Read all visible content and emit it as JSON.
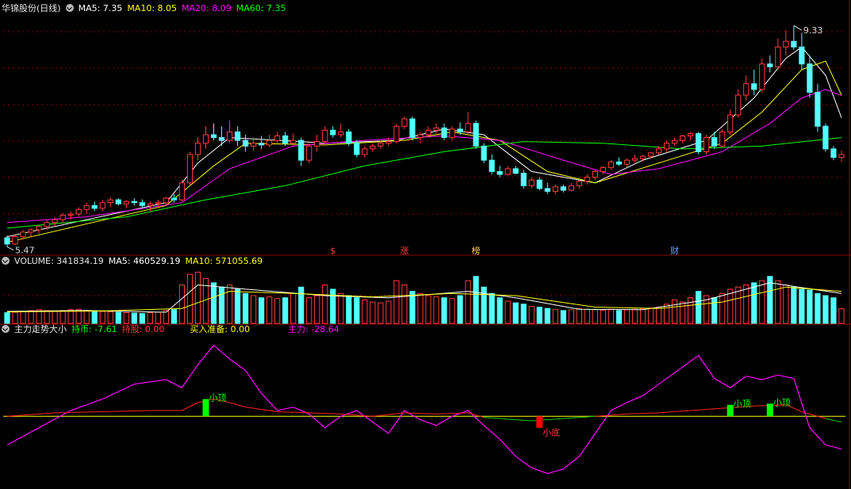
{
  "header": {
    "stock_name": "华锦股份(日线)",
    "ma5": "MA5: 7.35",
    "ma10": "MA10: 8.05",
    "ma20": "MA20: 8.09",
    "ma60": "MA60: 7.35"
  },
  "volume_header": {
    "volume": "VOLUME: 341834.19",
    "ma5": "MA5: 460529.19",
    "ma10": "MA10: 571055.69"
  },
  "indicator_header": {
    "name": "主力走势大小",
    "hold_coin": "持币: -7.61",
    "hold_stock": "持股: 0.00",
    "buy_ready": "买入准备: 0.00",
    "main_force": "主力: -28.64"
  },
  "price_labels": {
    "high": "9.33",
    "low": "5.47"
  },
  "event_markers": [
    {
      "text": "$",
      "i": 41,
      "color": "#ff3c3c"
    },
    {
      "text": "涨",
      "i": 50,
      "color": "#ff3c3c"
    },
    {
      "text": "榜",
      "i": 59,
      "color": "#ffcc55"
    },
    {
      "text": "财",
      "i": 84,
      "color": "#6aa0ff"
    }
  ],
  "signal_labels": [
    {
      "text": "小顶",
      "i": 25,
      "color": "#00ff00"
    },
    {
      "text": "小底",
      "i": 67,
      "color": "#ff3c3c"
    },
    {
      "text": "小顶",
      "i": 91,
      "color": "#00ff00"
    },
    {
      "text": "小顶",
      "i": 96,
      "color": "#00ff00"
    }
  ],
  "colors": {
    "up": "#ff3c3c",
    "down": "#54ffff",
    "ma5": "#ffffff",
    "ma10": "#ffff00",
    "ma20": "#ff00ff",
    "ma60": "#00ff00",
    "grid": "#8b0000",
    "separator": "#8b0000"
  },
  "chart_data": {
    "type": "candlestick",
    "title": "华锦股份(日线)",
    "ylim": [
      5.3,
      9.5
    ],
    "ohlc": [
      [
        5.58,
        5.62,
        5.42,
        5.47
      ],
      [
        5.47,
        5.65,
        5.45,
        5.6
      ],
      [
        5.6,
        5.72,
        5.55,
        5.68
      ],
      [
        5.68,
        5.75,
        5.6,
        5.72
      ],
      [
        5.72,
        5.8,
        5.65,
        5.78
      ],
      [
        5.78,
        5.9,
        5.72,
        5.85
      ],
      [
        5.85,
        5.95,
        5.78,
        5.9
      ],
      [
        5.9,
        6.02,
        5.85,
        5.98
      ],
      [
        5.98,
        6.05,
        5.9,
        6.0
      ],
      [
        6.0,
        6.12,
        5.95,
        6.08
      ],
      [
        6.08,
        6.2,
        6.0,
        6.15
      ],
      [
        6.15,
        6.22,
        6.05,
        6.1
      ],
      [
        6.1,
        6.25,
        6.05,
        6.2
      ],
      [
        6.2,
        6.3,
        6.12,
        6.25
      ],
      [
        6.25,
        6.28,
        6.15,
        6.18
      ],
      [
        6.18,
        6.25,
        6.1,
        6.22
      ],
      [
        6.22,
        6.28,
        6.15,
        6.2
      ],
      [
        6.2,
        6.26,
        6.12,
        6.15
      ],
      [
        6.15,
        6.22,
        6.05,
        6.18
      ],
      [
        6.18,
        6.25,
        6.1,
        6.2
      ],
      [
        6.2,
        6.3,
        6.15,
        6.28
      ],
      [
        6.28,
        6.35,
        6.2,
        6.25
      ],
      [
        6.25,
        6.6,
        6.22,
        6.55
      ],
      [
        6.55,
        7.1,
        6.5,
        7.05
      ],
      [
        7.05,
        7.35,
        6.95,
        7.25
      ],
      [
        7.25,
        7.55,
        7.15,
        7.4
      ],
      [
        7.4,
        7.6,
        7.3,
        7.35
      ],
      [
        7.35,
        7.55,
        7.2,
        7.3
      ],
      [
        7.3,
        7.65,
        7.25,
        7.45
      ],
      [
        7.45,
        7.55,
        7.2,
        7.3
      ],
      [
        7.3,
        7.4,
        7.1,
        7.2
      ],
      [
        7.2,
        7.35,
        7.12,
        7.25
      ],
      [
        7.25,
        7.38,
        7.15,
        7.22
      ],
      [
        7.22,
        7.4,
        7.18,
        7.3
      ],
      [
        7.3,
        7.45,
        7.25,
        7.38
      ],
      [
        7.38,
        7.45,
        7.2,
        7.25
      ],
      [
        7.25,
        7.42,
        7.2,
        7.3
      ],
      [
        7.3,
        7.35,
        6.85,
        6.95
      ],
      [
        6.95,
        7.25,
        6.9,
        7.2
      ],
      [
        7.2,
        7.4,
        7.1,
        7.28
      ],
      [
        7.28,
        7.55,
        7.25,
        7.48
      ],
      [
        7.48,
        7.55,
        7.35,
        7.4
      ],
      [
        7.4,
        7.6,
        7.35,
        7.45
      ],
      [
        7.45,
        7.5,
        7.2,
        7.25
      ],
      [
        7.25,
        7.3,
        7.0,
        7.05
      ],
      [
        7.05,
        7.2,
        7.0,
        7.15
      ],
      [
        7.15,
        7.25,
        7.1,
        7.2
      ],
      [
        7.2,
        7.3,
        7.15,
        7.25
      ],
      [
        7.25,
        7.35,
        7.2,
        7.28
      ],
      [
        7.28,
        7.6,
        7.25,
        7.55
      ],
      [
        7.55,
        7.72,
        7.5,
        7.68
      ],
      [
        7.68,
        7.72,
        7.3,
        7.35
      ],
      [
        7.35,
        7.45,
        7.25,
        7.4
      ],
      [
        7.4,
        7.55,
        7.35,
        7.48
      ],
      [
        7.48,
        7.6,
        7.4,
        7.52
      ],
      [
        7.52,
        7.6,
        7.3,
        7.35
      ],
      [
        7.35,
        7.55,
        7.3,
        7.5
      ],
      [
        7.5,
        7.62,
        7.4,
        7.45
      ],
      [
        7.45,
        7.8,
        7.4,
        7.6
      ],
      [
        7.6,
        7.65,
        7.15,
        7.2
      ],
      [
        7.2,
        7.25,
        6.9,
        6.95
      ],
      [
        6.95,
        7.05,
        6.7,
        6.75
      ],
      [
        6.75,
        6.85,
        6.65,
        6.7
      ],
      [
        6.7,
        6.85,
        6.68,
        6.8
      ],
      [
        6.8,
        6.85,
        6.7,
        6.72
      ],
      [
        6.72,
        6.78,
        6.45,
        6.5
      ],
      [
        6.5,
        6.65,
        6.45,
        6.6
      ],
      [
        6.6,
        6.65,
        6.42,
        6.45
      ],
      [
        6.45,
        6.55,
        6.35,
        6.4
      ],
      [
        6.4,
        6.52,
        6.35,
        6.48
      ],
      [
        6.48,
        6.52,
        6.38,
        6.42
      ],
      [
        6.42,
        6.55,
        6.4,
        6.5
      ],
      [
        6.5,
        6.6,
        6.45,
        6.58
      ],
      [
        6.58,
        6.7,
        6.52,
        6.65
      ],
      [
        6.65,
        6.78,
        6.6,
        6.75
      ],
      [
        6.75,
        6.85,
        6.7,
        6.82
      ],
      [
        6.82,
        6.95,
        6.78,
        6.92
      ],
      [
        6.92,
        7.0,
        6.85,
        6.88
      ],
      [
        6.88,
        6.98,
        6.82,
        6.95
      ],
      [
        6.95,
        7.05,
        6.9,
        6.98
      ],
      [
        6.98,
        7.05,
        6.92,
        7.02
      ],
      [
        7.02,
        7.1,
        6.98,
        7.08
      ],
      [
        7.08,
        7.2,
        7.05,
        7.15
      ],
      [
        7.15,
        7.3,
        7.1,
        7.25
      ],
      [
        7.25,
        7.35,
        7.2,
        7.3
      ],
      [
        7.3,
        7.4,
        7.25,
        7.38
      ],
      [
        7.38,
        7.45,
        7.3,
        7.42
      ],
      [
        7.42,
        7.45,
        7.05,
        7.1
      ],
      [
        7.1,
        7.4,
        7.05,
        7.35
      ],
      [
        7.35,
        7.45,
        7.15,
        7.2
      ],
      [
        7.2,
        7.5,
        7.18,
        7.45
      ],
      [
        7.45,
        7.85,
        7.4,
        7.75
      ],
      [
        7.75,
        8.2,
        7.7,
        8.1
      ],
      [
        8.1,
        8.45,
        8.0,
        8.3
      ],
      [
        8.3,
        8.55,
        8.1,
        8.2
      ],
      [
        8.2,
        8.75,
        8.15,
        8.65
      ],
      [
        8.65,
        8.8,
        8.5,
        8.6
      ],
      [
        8.6,
        9.1,
        8.55,
        8.95
      ],
      [
        8.95,
        9.25,
        8.8,
        9.05
      ],
      [
        9.05,
        9.33,
        8.9,
        8.95
      ],
      [
        8.95,
        9.2,
        8.55,
        8.65
      ],
      [
        8.65,
        8.8,
        8.05,
        8.15
      ],
      [
        8.15,
        8.3,
        7.45,
        7.55
      ],
      [
        7.55,
        7.6,
        7.1,
        7.15
      ],
      [
        7.15,
        7.2,
        6.95,
        7.0
      ],
      [
        7.0,
        7.12,
        6.92,
        7.05
      ]
    ],
    "volume_ylim": [
      0,
      1300000
    ],
    "volume": [
      250000,
      260000,
      280000,
      300000,
      320000,
      300000,
      280000,
      300000,
      320000,
      330000,
      300000,
      290000,
      280000,
      270000,
      260000,
      250000,
      240000,
      230000,
      250000,
      260000,
      300000,
      320000,
      900000,
      1150000,
      1200000,
      1050000,
      950000,
      850000,
      900000,
      800000,
      700000,
      650000,
      600000,
      620000,
      580000,
      600000,
      700000,
      850000,
      600000,
      650000,
      900000,
      800000,
      700000,
      650000,
      600000,
      550000,
      500000,
      480000,
      520000,
      1000000,
      900000,
      750000,
      700000,
      650000,
      620000,
      600000,
      580000,
      650000,
      1000000,
      1100000,
      850000,
      700000,
      600000,
      520000,
      480000,
      450000,
      400000,
      380000,
      350000,
      330000,
      300000,
      320000,
      350000,
      330000,
      320000,
      310000,
      330000,
      300000,
      320000,
      330000,
      350000,
      360000,
      380000,
      450000,
      550000,
      500000,
      600000,
      750000,
      650000,
      600000,
      700000,
      800000,
      850000,
      900000,
      950000,
      1000000,
      1100000,
      1000000,
      900000,
      850000,
      800000,
      780000,
      700000,
      650000,
      600000,
      341834
    ],
    "ma_series": [
      {
        "name": "MA5",
        "points": [
          [
            0,
            5.6
          ],
          [
            20,
            6.2
          ],
          [
            24,
            6.9
          ],
          [
            28,
            7.35
          ],
          [
            37,
            7.28
          ],
          [
            40,
            7.25
          ],
          [
            49,
            7.3
          ],
          [
            55,
            7.5
          ],
          [
            60,
            7.4
          ],
          [
            66,
            6.75
          ],
          [
            74,
            6.55
          ],
          [
            80,
            6.95
          ],
          [
            88,
            7.3
          ],
          [
            94,
            8.05
          ],
          [
            98,
            8.75
          ],
          [
            100,
            8.95
          ],
          [
            103,
            8.45
          ],
          [
            105,
            7.7
          ]
        ]
      },
      {
        "name": "MA10",
        "points": [
          [
            0,
            5.5
          ],
          [
            20,
            6.15
          ],
          [
            26,
            6.85
          ],
          [
            30,
            7.25
          ],
          [
            40,
            7.22
          ],
          [
            50,
            7.3
          ],
          [
            56,
            7.45
          ],
          [
            62,
            7.3
          ],
          [
            68,
            6.75
          ],
          [
            74,
            6.55
          ],
          [
            82,
            6.9
          ],
          [
            90,
            7.25
          ],
          [
            95,
            7.8
          ],
          [
            100,
            8.55
          ],
          [
            103,
            8.7
          ],
          [
            105,
            8.1
          ]
        ]
      },
      {
        "name": "MA20",
        "points": [
          [
            0,
            5.85
          ],
          [
            10,
            5.95
          ],
          [
            22,
            6.2
          ],
          [
            28,
            6.8
          ],
          [
            36,
            7.2
          ],
          [
            45,
            7.3
          ],
          [
            55,
            7.38
          ],
          [
            62,
            7.3
          ],
          [
            70,
            6.95
          ],
          [
            76,
            6.7
          ],
          [
            82,
            6.8
          ],
          [
            90,
            7.1
          ],
          [
            96,
            7.6
          ],
          [
            100,
            8.05
          ],
          [
            103,
            8.2
          ],
          [
            105,
            8.09
          ]
        ]
      },
      {
        "name": "MA60",
        "points": [
          [
            0,
            5.75
          ],
          [
            15,
            5.95
          ],
          [
            25,
            6.25
          ],
          [
            35,
            6.5
          ],
          [
            45,
            6.85
          ],
          [
            55,
            7.1
          ],
          [
            65,
            7.28
          ],
          [
            75,
            7.25
          ],
          [
            85,
            7.15
          ],
          [
            95,
            7.2
          ],
          [
            105,
            7.35
          ]
        ]
      }
    ],
    "volume_ma": [
      {
        "name": "MA5",
        "points": [
          [
            0,
            280000
          ],
          [
            10,
            300000
          ],
          [
            20,
            260000
          ],
          [
            24,
            900000
          ],
          [
            30,
            800000
          ],
          [
            40,
            650000
          ],
          [
            48,
            600000
          ],
          [
            58,
            750000
          ],
          [
            64,
            600000
          ],
          [
            72,
            330000
          ],
          [
            80,
            320000
          ],
          [
            88,
            550000
          ],
          [
            96,
            950000
          ],
          [
            105,
            700000
          ]
        ]
      },
      {
        "name": "MA10",
        "points": [
          [
            0,
            270000
          ],
          [
            12,
            290000
          ],
          [
            22,
            350000
          ],
          [
            28,
            750000
          ],
          [
            36,
            700000
          ],
          [
            46,
            620000
          ],
          [
            56,
            700000
          ],
          [
            64,
            650000
          ],
          [
            74,
            380000
          ],
          [
            82,
            350000
          ],
          [
            90,
            500000
          ],
          [
            98,
            850000
          ],
          [
            105,
            750000
          ]
        ]
      }
    ],
    "indicator_ylim": [
      -60,
      70
    ],
    "indicator_zero": 0,
    "main_force_line": [
      [
        0,
        -25
      ],
      [
        4,
        -10
      ],
      [
        8,
        5
      ],
      [
        12,
        15
      ],
      [
        16,
        28
      ],
      [
        20,
        32
      ],
      [
        22,
        25
      ],
      [
        24,
        45
      ],
      [
        26,
        62
      ],
      [
        28,
        50
      ],
      [
        30,
        40
      ],
      [
        32,
        20
      ],
      [
        34,
        5
      ],
      [
        36,
        8
      ],
      [
        38,
        2
      ],
      [
        40,
        -10
      ],
      [
        42,
        0
      ],
      [
        44,
        5
      ],
      [
        46,
        -5
      ],
      [
        48,
        -15
      ],
      [
        50,
        5
      ],
      [
        52,
        -3
      ],
      [
        54,
        -8
      ],
      [
        56,
        0
      ],
      [
        58,
        5
      ],
      [
        60,
        -8
      ],
      [
        62,
        -20
      ],
      [
        64,
        -35
      ],
      [
        66,
        -45
      ],
      [
        68,
        -50
      ],
      [
        70,
        -46
      ],
      [
        72,
        -35
      ],
      [
        74,
        -15
      ],
      [
        76,
        5
      ],
      [
        78,
        12
      ],
      [
        80,
        18
      ],
      [
        82,
        28
      ],
      [
        84,
        38
      ],
      [
        86,
        48
      ],
      [
        87,
        53
      ],
      [
        89,
        33
      ],
      [
        91,
        25
      ],
      [
        93,
        35
      ],
      [
        95,
        32
      ],
      [
        97,
        36
      ],
      [
        99,
        33
      ],
      [
        101,
        -10
      ],
      [
        103,
        -25
      ],
      [
        105,
        -28.64
      ]
    ],
    "red_line": [
      [
        0,
        0
      ],
      [
        6,
        3
      ],
      [
        12,
        4
      ],
      [
        18,
        5
      ],
      [
        22,
        5
      ],
      [
        24,
        12
      ],
      [
        26,
        15
      ],
      [
        28,
        12
      ],
      [
        30,
        8
      ],
      [
        34,
        4
      ],
      [
        38,
        3
      ],
      [
        42,
        2
      ],
      [
        46,
        0
      ],
      [
        50,
        3
      ],
      [
        54,
        2
      ],
      [
        58,
        3
      ],
      [
        60,
        -1
      ],
      [
        64,
        -3
      ],
      [
        66,
        -4
      ],
      [
        70,
        -2
      ],
      [
        74,
        0
      ],
      [
        78,
        2
      ],
      [
        82,
        3
      ],
      [
        86,
        5
      ],
      [
        90,
        7
      ],
      [
        94,
        9
      ],
      [
        98,
        10
      ],
      [
        100,
        4
      ],
      [
        103,
        -2
      ],
      [
        105,
        -5
      ]
    ],
    "signal_bars": [
      {
        "i": 25,
        "from": 0,
        "to": 15,
        "color": "#00ff00"
      },
      {
        "i": 67,
        "from": 0,
        "to": -10,
        "color": "#ff0000"
      },
      {
        "i": 91,
        "from": 0,
        "to": 10,
        "color": "#00ff00"
      },
      {
        "i": 96,
        "from": 0,
        "to": 11,
        "color": "#00ff00"
      }
    ]
  }
}
